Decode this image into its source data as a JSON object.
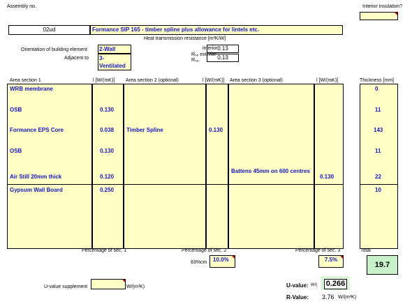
{
  "header": {
    "assembly_label": "Assembly no.",
    "interior_insulation_label": "Interior insulation?",
    "assembly_no": "02ud",
    "assembly_name": "Formance SIP 165 - timber spline plus allowance for lintels etc."
  },
  "resistance": {
    "title": "Heat transmission resistance  [m²K/W]",
    "interior_label": "interior",
    "exterior_label": "Rₛₑ exterior",
    "rse_label": "Rₛₑ.",
    "interior_value": "0.13",
    "exterior_value": "0.13"
  },
  "orientation": {
    "label": "Orientation of building element",
    "value": "2-Wall",
    "adjacent_label": "Adjacent to",
    "adjacent_value": "3-\nVentilated"
  },
  "columns": {
    "area1": "Area section 1",
    "l1": "l [W/(mK)]",
    "area2": "Area section 2 (optional)",
    "l2": "l [W/(mK)]",
    "area3": "Area section 3 (optional)",
    "l3": "l [W/(mK)]",
    "thickness": "Thickness [mm]"
  },
  "layers": [
    {
      "s1": "WRB membrane",
      "l1": "",
      "s2": "",
      "l2": "",
      "s3": "",
      "l3": "",
      "t": "0"
    },
    {
      "s1": "OSB",
      "l1": "0.130",
      "s2": "",
      "l2": "",
      "s3": "",
      "l3": "",
      "t": "11"
    },
    {
      "s1": "Formance EPS Core",
      "l1": "0.038",
      "s2": "Timber Spline",
      "l2": "0.130",
      "s3": "",
      "l3": "",
      "t": "143"
    },
    {
      "s1": "OSB",
      "l1": "0.130",
      "s2": "",
      "l2": "",
      "s3": "",
      "l3": "",
      "t": "11"
    },
    {
      "s1": "Air Still 20mm thick",
      "l1": "0.120",
      "s2": "",
      "l2": "",
      "s3": "Battens 45mm on 600 centres",
      "l3": "0.130",
      "t": "22"
    },
    {
      "s1": "Gypsum Wall Board",
      "l1": "0.250",
      "s2": "",
      "l2": "",
      "s3": "",
      "l3": "",
      "t": "10"
    }
  ],
  "footer": {
    "pct1_label": "Percentage of sec. 1",
    "pct2_label": "Percentage of sec. 2",
    "pct3_label": "Percentage of sec. 3",
    "total_label": "Total",
    "pct2_prefix": "83%cm",
    "pct2_value": "10.0%",
    "pct3_value": "7.5%",
    "total_value": "19.7",
    "supplement_label": "U-value supplement",
    "supplement_unit": "W/(m²K)",
    "u_label": "U-value:",
    "u_unit_prefix": "W/(",
    "u_value": "0.266",
    "r_label": "R-Value:",
    "r_value": "3.76",
    "r_unit": "W/(m²K)"
  },
  "colors": {
    "cell_yellow": "#ffffc6",
    "text_blue": "#1515c8",
    "total_green": "#c8f0c8",
    "u_green": "#dcf5dc"
  }
}
